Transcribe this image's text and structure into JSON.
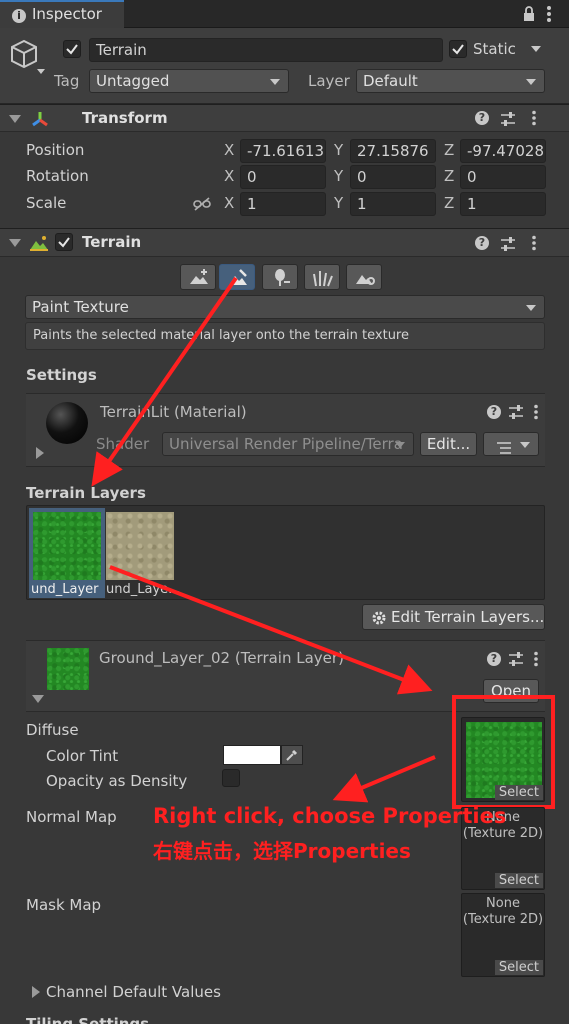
{
  "tab": {
    "label": "Inspector"
  },
  "object": {
    "name": "Terrain",
    "static_label": "Static",
    "tag_label": "Tag",
    "tag_value": "Untagged",
    "layer_label": "Layer",
    "layer_value": "Default"
  },
  "transform": {
    "title": "Transform",
    "rows": [
      {
        "label": "Position",
        "x": "-71.61613",
        "y": "27.15876",
        "z": "-97.47028"
      },
      {
        "label": "Rotation",
        "x": "0",
        "y": "0",
        "z": "0"
      },
      {
        "label": "Scale",
        "x": "1",
        "y": "1",
        "z": "1"
      }
    ],
    "axis": {
      "x": "X",
      "y": "Y",
      "z": "Z"
    }
  },
  "terrain": {
    "title": "Terrain",
    "mode": "Paint Texture",
    "mode_description": "Paints the selected material layer onto the terrain texture",
    "settings_label": "Settings",
    "material_name": "TerrainLit (Material)",
    "shader_label": "Shader",
    "shader_value": "Universal Render Pipeline/Terra",
    "edit_button": "Edit...",
    "layers_label": "Terrain Layers",
    "layer_thumbs": [
      {
        "caption": "und_Layer"
      },
      {
        "caption": "und_Laye..."
      }
    ],
    "edit_layers_button": "Edit Terrain Layers..."
  },
  "layer_asset": {
    "title": "Ground_Layer_02 (Terrain Layer)",
    "open_button": "Open",
    "diffuse_label": "Diffuse",
    "color_tint_label": "Color Tint",
    "opacity_label": "Opacity as Density",
    "normal_map_label": "Normal Map",
    "mask_map_label": "Mask Map",
    "none_line1": "None",
    "none_line2": "(Texture 2D)",
    "select_label": "Select",
    "channel_defaults_label": "Channel Default Values",
    "tiling_label": "Tiling Settings"
  },
  "annotation": {
    "line1": "Right click, choose Properties",
    "line2": "右键点击，选择Properties",
    "color": "#ff2020"
  }
}
